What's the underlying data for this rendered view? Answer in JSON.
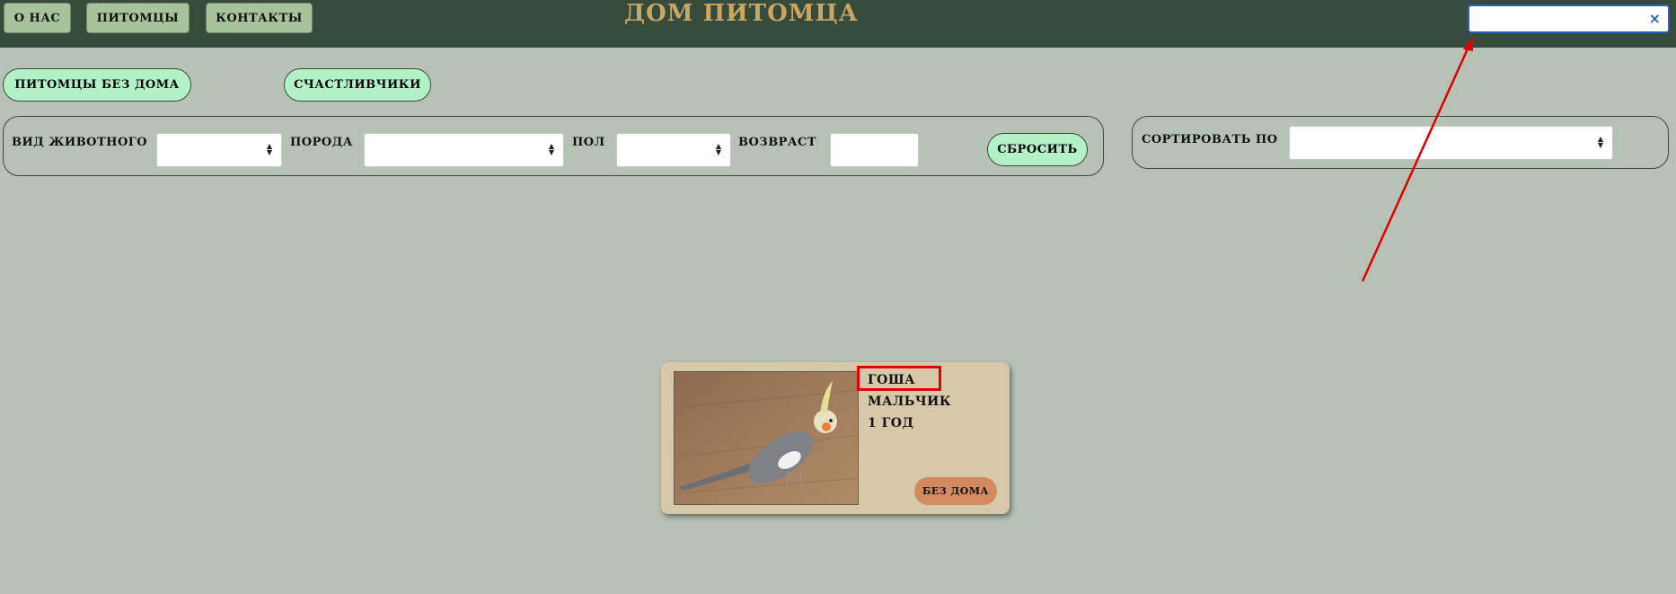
{
  "nav": {
    "about": "О НАС",
    "pets": "ПИТОМЦЫ",
    "contacts": "КОНТАКТЫ"
  },
  "site_title": "ДОМ ПИТОМЦА",
  "search": {
    "value": "",
    "placeholder": "",
    "clear": "×"
  },
  "tabs": {
    "homeless": "ПИТОМЦЫ БЕЗ ДОМА",
    "lucky": "СЧАСТЛИВЧИКИ"
  },
  "filters": {
    "species_label": "ВИД ЖИВОТНОГО",
    "breed_label": "ПОРОДА",
    "sex_label": "ПОЛ",
    "age_label": "ВОЗВРАСТ",
    "reset": "СБРОСИТЬ"
  },
  "sort": {
    "label": "СОРТИРОВАТЬ ПО"
  },
  "pet_card": {
    "name": "ГОША",
    "sex": "МАЛЬЧИК",
    "age": "1 ГОД",
    "status": "БЕЗ ДОМА"
  },
  "colors": {
    "header_bg": "#374b3b",
    "page_bg": "#b6c2b6",
    "accent_green": "#b3f2c7",
    "card_bg": "#d6c8a8",
    "status_badge": "#d38a5f",
    "annotation_red": "#e00000"
  }
}
